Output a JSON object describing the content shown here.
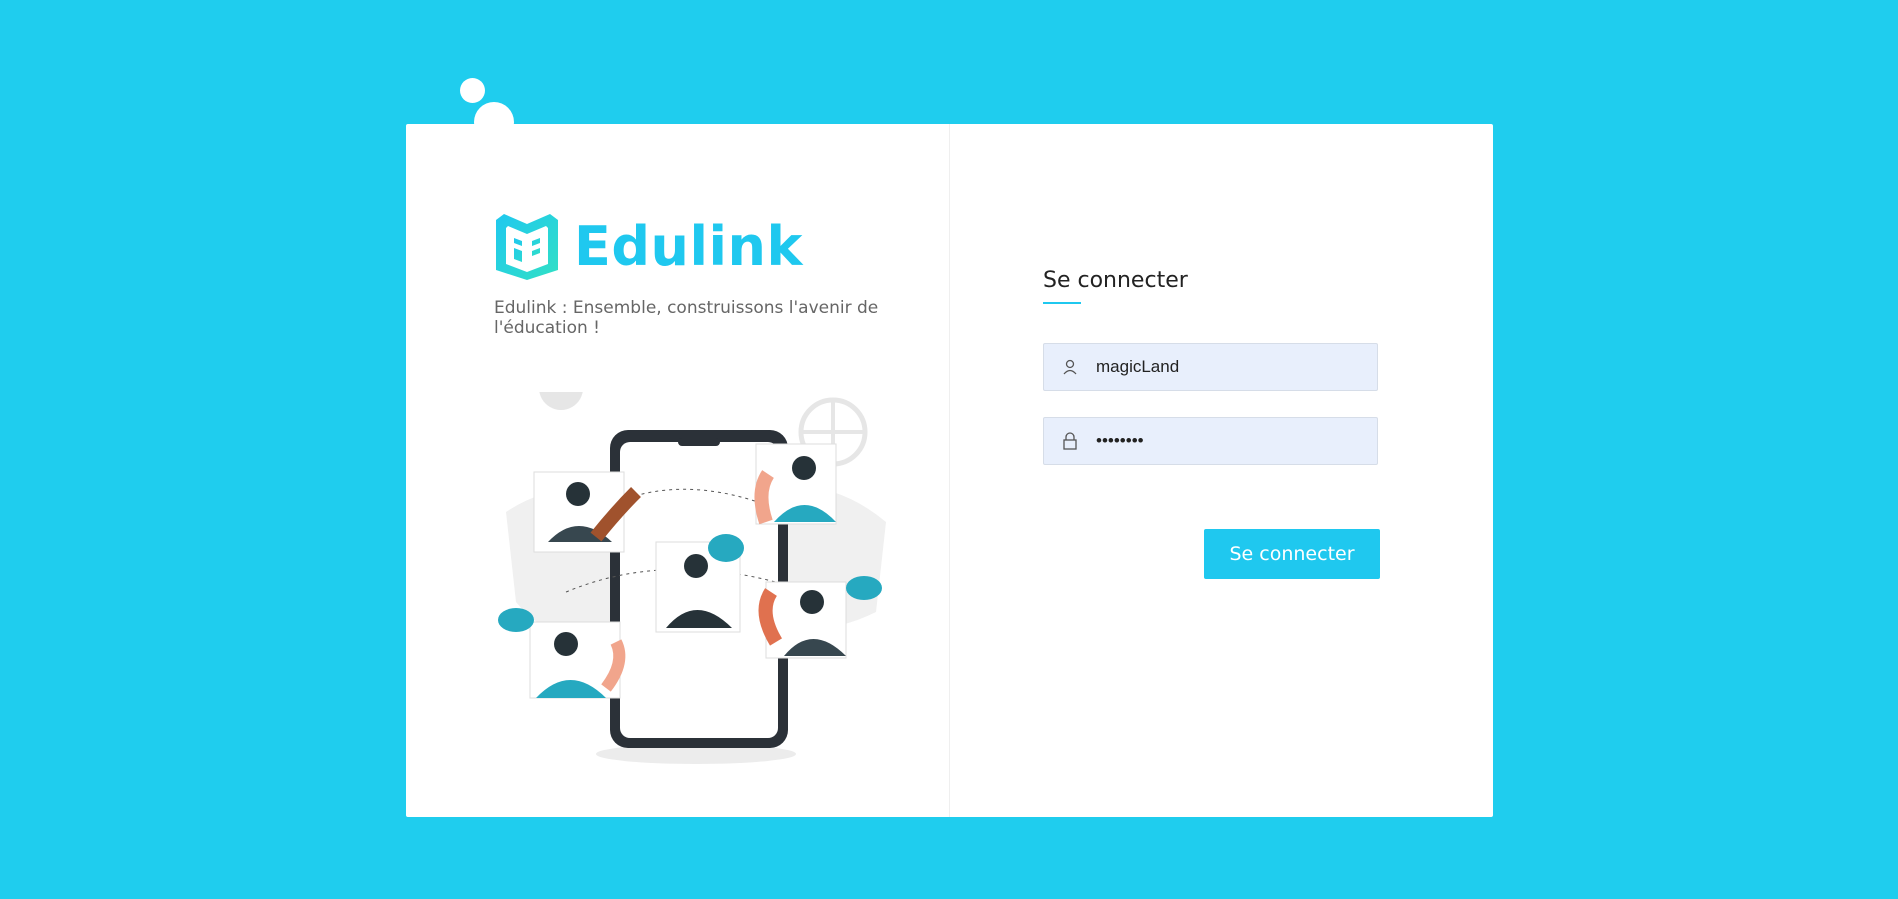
{
  "brand": {
    "name": "Edulink",
    "tagline": "Edulink : Ensemble, construissons l'avenir de l'éducation !",
    "accent_color": "#1fc8ef",
    "background_color": "#1fcdee"
  },
  "login": {
    "title": "Se connecter",
    "username": {
      "value": "magicLand",
      "icon": "user-icon"
    },
    "password": {
      "value": "••••••••",
      "icon": "lock-icon"
    },
    "submit_label": "Se connecter"
  },
  "illustration": {
    "icon": "people-connecting-phone-illustration"
  }
}
